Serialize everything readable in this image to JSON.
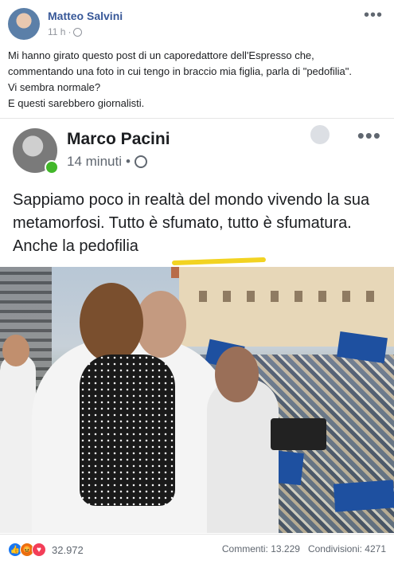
{
  "post": {
    "author": "Matteo Salvini",
    "time": "11 h",
    "menu_dots": "•••",
    "text_lines": [
      "Mi hanno girato questo post di un caporedattore dell'Espresso che,",
      "commentando una foto in cui tengo in braccio mia figlia, parla di \"pedofilia\".",
      "Vi sembra normale?",
      "E questi sarebbero giornalisti."
    ]
  },
  "embedded": {
    "author": "Marco Pacini",
    "time": "14 minuti",
    "menu_dots": "•••",
    "text": "Sappiamo poco in realtà del mondo vivendo la sua metamorfosi. Tutto è sfumato, tutto è sfumatura. Anche la pedofilia"
  },
  "footer": {
    "reactions_count": "32.972",
    "comments": "Commenti: 13.229",
    "shares": "Condivisioni: 4271"
  },
  "colors": {
    "link_blue": "#385898",
    "like_blue": "#1877f2",
    "angry_orange": "#e9710f",
    "love_red": "#f33e58",
    "highlight_yellow": "#f2d322"
  }
}
